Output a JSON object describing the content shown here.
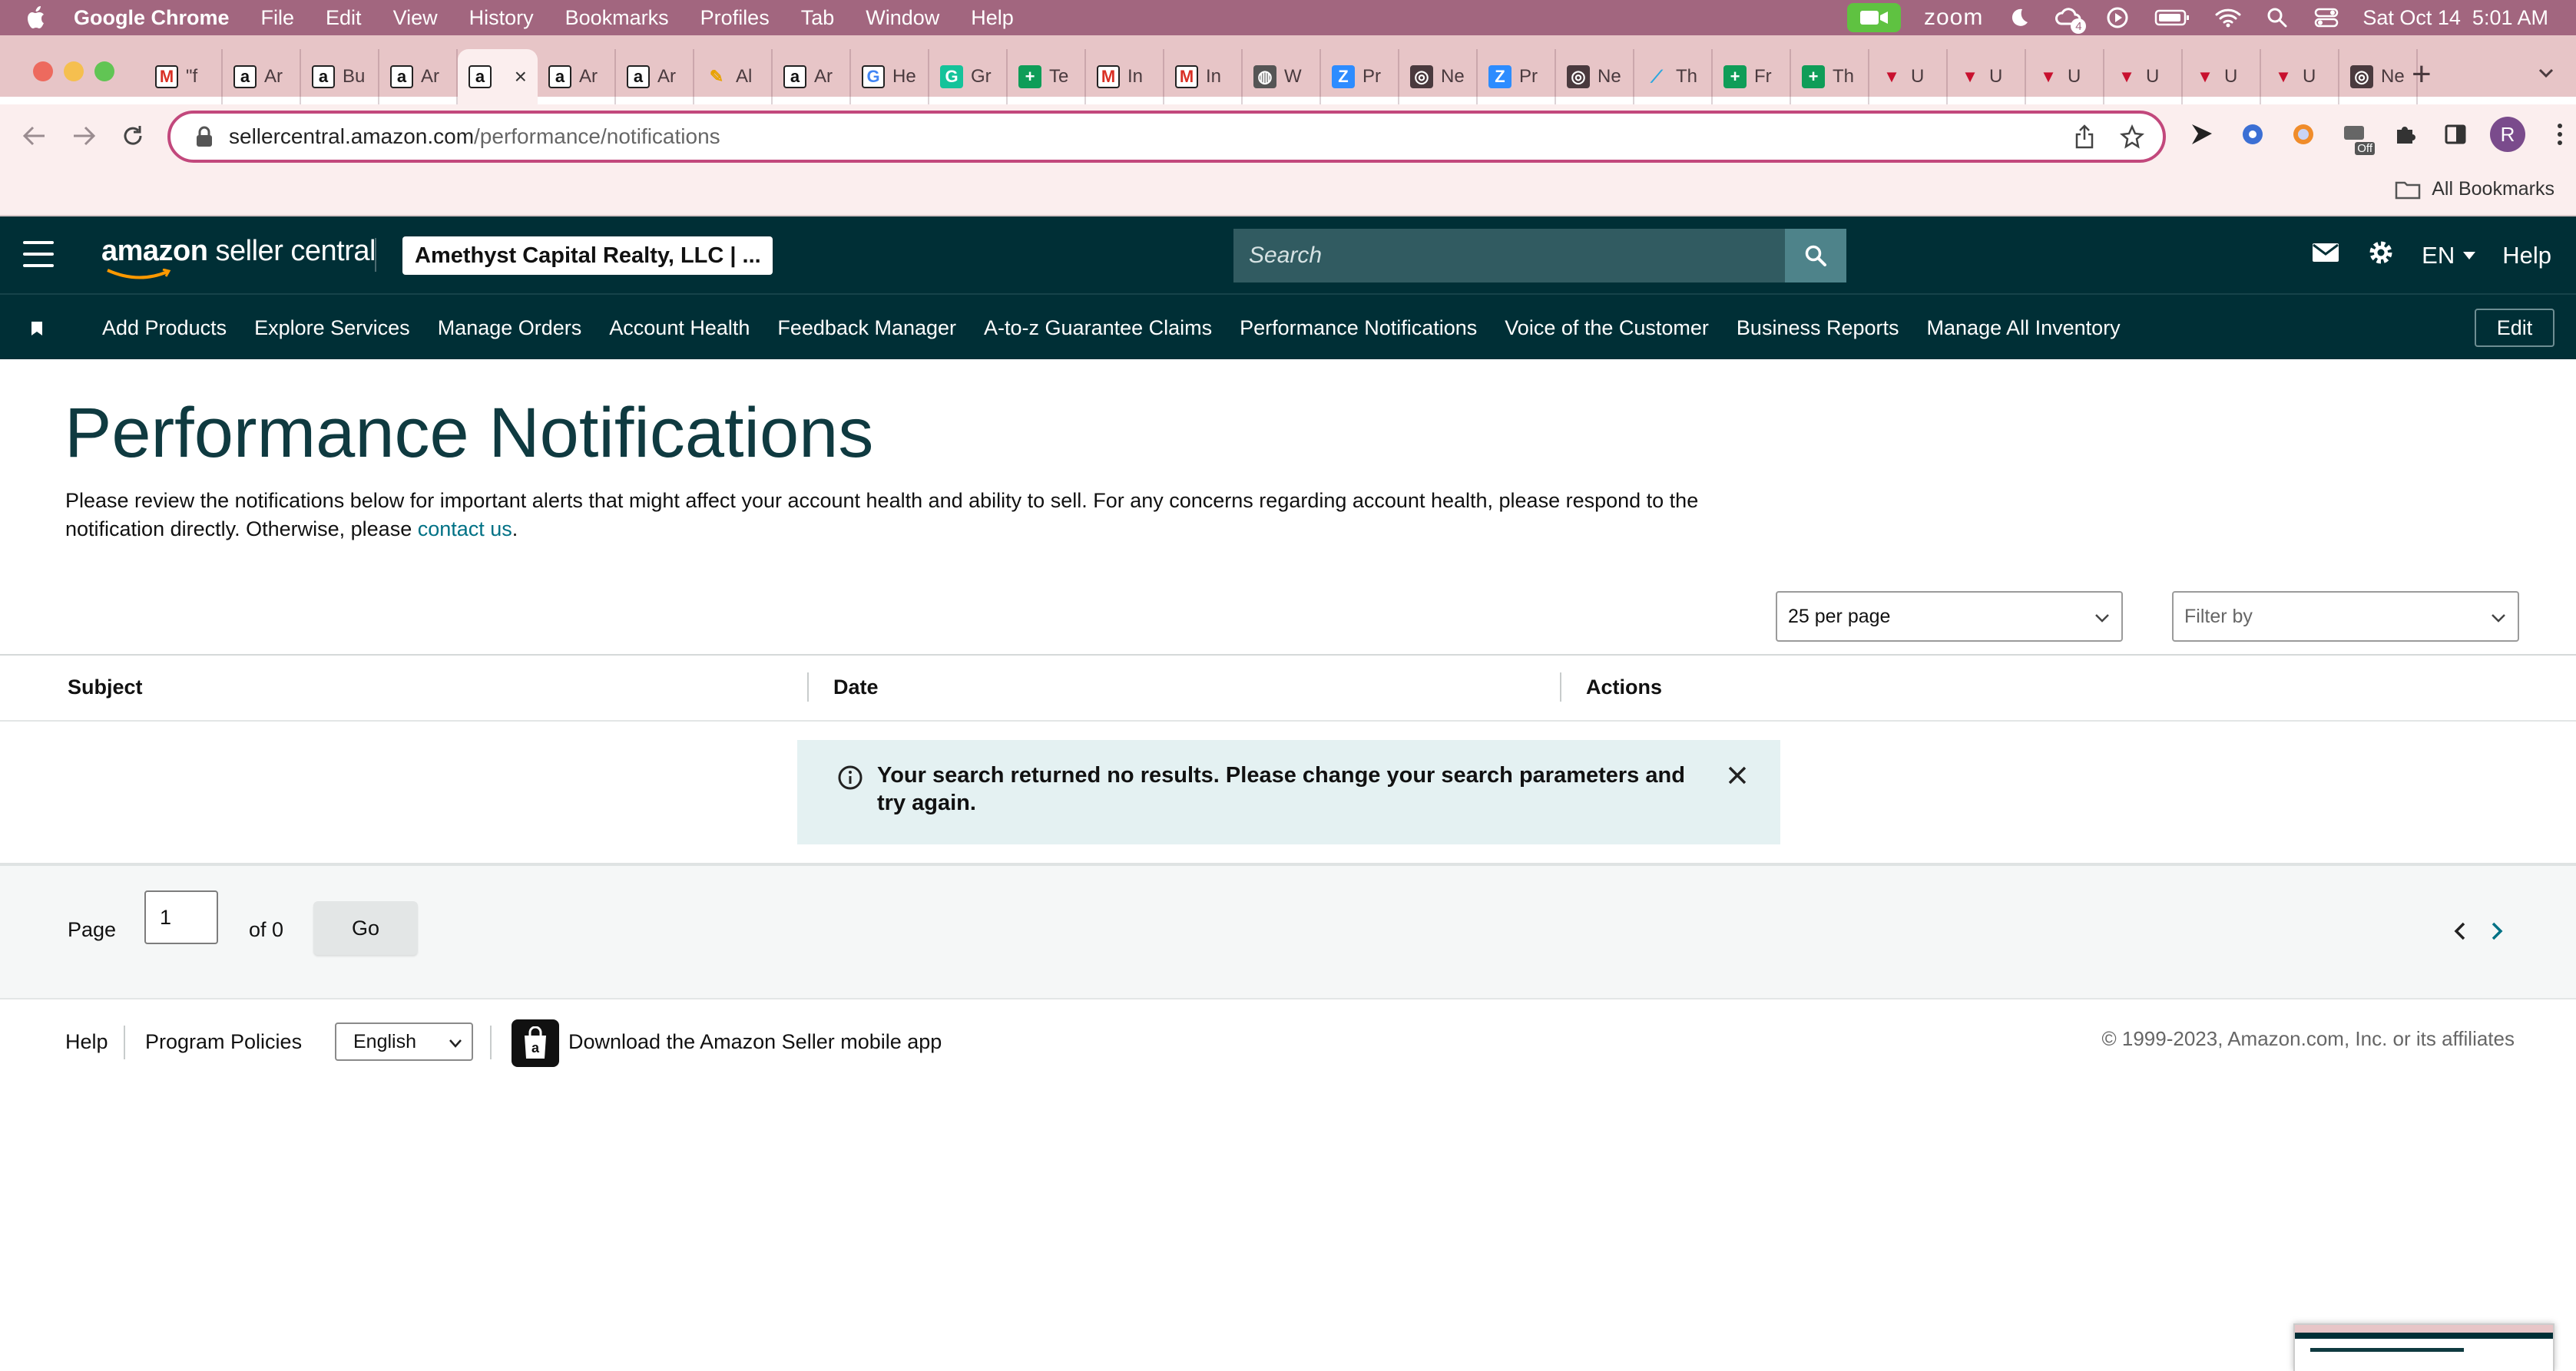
{
  "mac_menubar": {
    "app_name": "Google Chrome",
    "menus": [
      "File",
      "Edit",
      "View",
      "History",
      "Bookmarks",
      "Profiles",
      "Tab",
      "Window",
      "Help"
    ],
    "zoom_label": "zoom",
    "notification_count": "4",
    "datetime": "Sat Oct 14  5:01 AM"
  },
  "tabs": [
    {
      "icon": "gmail-icon",
      "label": "\"f"
    },
    {
      "icon": "amazon-icon",
      "label": "Ar"
    },
    {
      "icon": "amazon-icon",
      "label": "Bu"
    },
    {
      "icon": "amazon-icon",
      "label": "Ar"
    },
    {
      "icon": "amazon-icon",
      "label": "",
      "active": true
    },
    {
      "icon": "amazon-icon",
      "label": "Ar"
    },
    {
      "icon": "amazon-icon",
      "label": "Ar"
    },
    {
      "icon": "pencil-icon",
      "label": "Al"
    },
    {
      "icon": "amazon-icon",
      "label": "Ar"
    },
    {
      "icon": "google-icon",
      "label": "He"
    },
    {
      "icon": "grammarly-icon",
      "label": "Gr"
    },
    {
      "icon": "sheets-icon",
      "label": "Te"
    },
    {
      "icon": "gmail-icon",
      "label": "In"
    },
    {
      "icon": "gmail-icon",
      "label": "In"
    },
    {
      "icon": "globe-icon",
      "label": "W"
    },
    {
      "icon": "zoom-icon",
      "label": "Pr"
    },
    {
      "icon": "chrome-icon",
      "label": "Ne"
    },
    {
      "icon": "zoom-icon",
      "label": "Pr"
    },
    {
      "icon": "chrome-icon",
      "label": "Ne"
    },
    {
      "icon": "feather-icon",
      "label": "Th"
    },
    {
      "icon": "sheets-icon",
      "label": "Fr"
    },
    {
      "icon": "sheets-icon",
      "label": "Th"
    },
    {
      "icon": "shield-icon",
      "label": "U"
    },
    {
      "icon": "shield-icon",
      "label": "U"
    },
    {
      "icon": "shield-icon",
      "label": "U"
    },
    {
      "icon": "shield-icon",
      "label": "U"
    },
    {
      "icon": "shield-icon",
      "label": "U"
    },
    {
      "icon": "shield-icon",
      "label": "U"
    },
    {
      "icon": "chrome-icon",
      "label": "Ne"
    }
  ],
  "browser": {
    "url_host": "sellercentral.amazon.com",
    "url_path": "/performance/notifications",
    "profile_initial": "R",
    "extension_badge": "Off",
    "all_bookmarks": "All Bookmarks"
  },
  "header": {
    "logo_main": "amazon",
    "logo_sub": " seller central",
    "account": "Amethyst Capital Realty, LLC | ...",
    "search_placeholder": "Search",
    "language": "EN",
    "help": "Help"
  },
  "nav": {
    "links": [
      "Add Products",
      "Explore Services",
      "Manage Orders",
      "Account Health",
      "Feedback Manager",
      "A-to-z Guarantee Claims",
      "Performance Notifications",
      "Voice of the Customer",
      "Business Reports",
      "Manage All Inventory"
    ],
    "edit": "Edit"
  },
  "main": {
    "title": "Performance Notifications",
    "description": "Please review the notifications below for important alerts that might affect your account health and ability to sell. For any concerns regarding account health, please respond to the notification directly. Otherwise, please ",
    "contact_link": "contact us",
    "description_end": ".",
    "per_page": "25 per page",
    "filter_placeholder": "Filter by",
    "columns": [
      "Subject",
      "Date",
      "Actions"
    ],
    "alert": "Your search returned no results. Please change your search parameters and try again.",
    "pager": {
      "page_label": "Page",
      "page_value": "1",
      "of_label": "of 0",
      "go": "Go"
    }
  },
  "footer": {
    "help": "Help",
    "policies": "Program Policies",
    "language": "English",
    "app_text": "Download the Amazon Seller mobile app",
    "copyright": "© 1999-2023, Amazon.com, Inc. or its affiliates"
  },
  "colors": {
    "menubar": "#a2667f",
    "tabstrip": "#e7c5c7",
    "header": "#002f36",
    "title": "#0f3a40",
    "link": "#007185",
    "alert_bg": "#e4f1f2"
  }
}
